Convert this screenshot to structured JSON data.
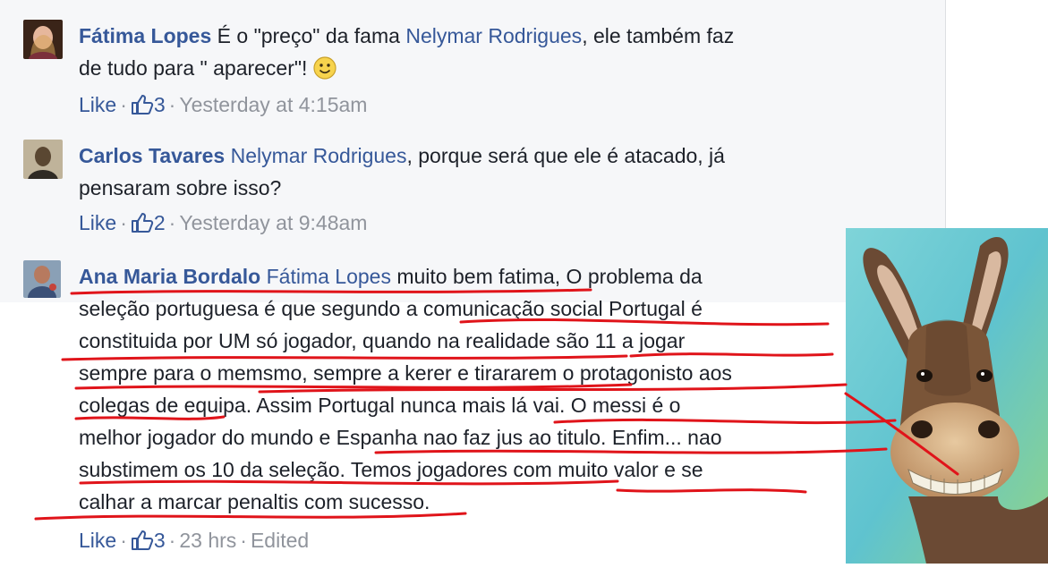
{
  "comments": [
    {
      "author": "Fátima Lopes",
      "text_1": "É o \"preço\" da fama ",
      "mention": "Nelymar Rodrigues",
      "text_2": ", ele também faz",
      "line2": "de tudo para \" aparecer\"! ",
      "like_label": "Like",
      "likes": "3",
      "time": "Yesterday at 4:15am",
      "avatar_color": "#c7866c"
    },
    {
      "author": "Carlos Tavares",
      "mention": "Nelymar Rodrigues",
      "text_2": ", porque será que ele é atacado, já",
      "line2": "pensaram sobre isso?",
      "like_label": "Like",
      "likes": "2",
      "time": "Yesterday at 9:48am",
      "avatar_color": "#6b5a44"
    },
    {
      "author": "Ana Maria Bordalo",
      "mention": "Fátima Lopes",
      "line1_rest": " muito bem fatima, O problema da",
      "lines": [
        "seleção portuguesa é que segundo a comunicação social Portugal é",
        "constituida por UM só jogador, quando na realidade são 11 a jogar",
        "sempre para o memsmo, sempre a kerer e tirararem o protagonisto aos",
        "colegas de equipa. Assim Portugal nunca mais lá vai. O messi é o",
        "melhor jogador do mundo e Espanha nao faz jus ao titulo. Enfim... nao",
        "substimem os 10 da seleção. Temos jogadores com muito valor e se",
        "calhar a marcar penaltis com sucesso."
      ],
      "like_label": "Like",
      "likes": "3",
      "time": "23 hrs",
      "edited": "Edited",
      "avatar_color": "#5b6f9a"
    }
  ],
  "separator": "·",
  "colors": {
    "link": "#365899",
    "meta": "#90949c",
    "scribble": "#e0141a"
  },
  "icons": [
    "thumbs-up-icon",
    "smiley-icon",
    "donkey-image"
  ]
}
